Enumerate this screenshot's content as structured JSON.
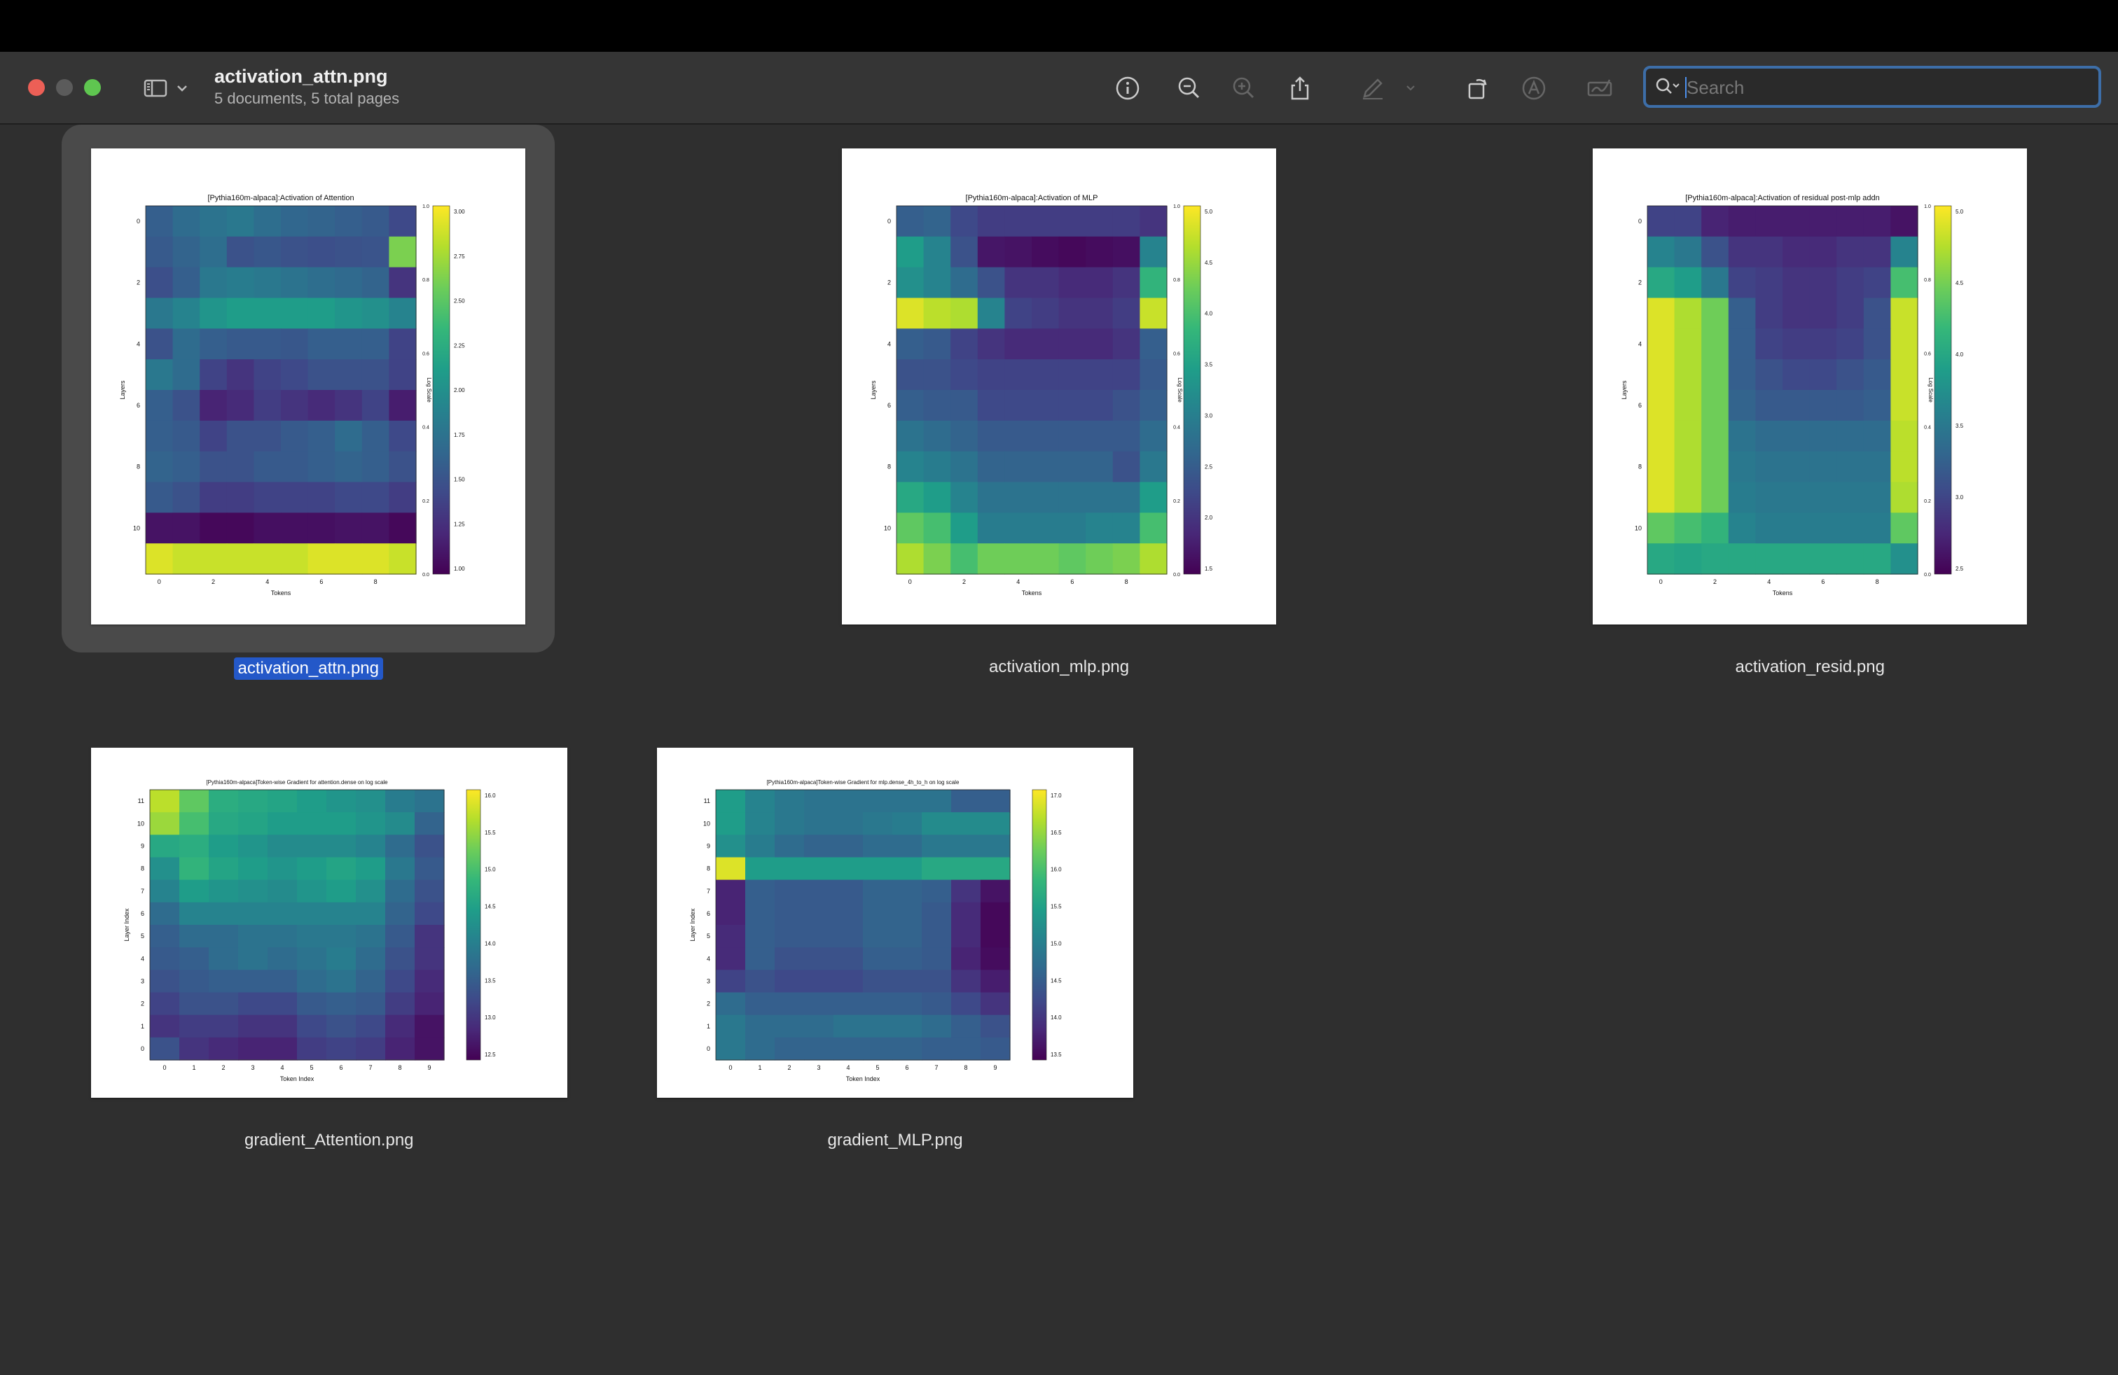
{
  "window": {
    "title": "activation_attn.png",
    "subtitle": "5 documents, 5 total pages"
  },
  "toolbar": {
    "icons": [
      "sidebar-icon",
      "chevron-down-icon",
      "info-icon",
      "zoom-out-icon",
      "zoom-in-icon",
      "share-icon",
      "markup-pen-icon",
      "chevron-down-icon",
      "rotate-icon",
      "annotate-icon",
      "signature-icon"
    ]
  },
  "search": {
    "placeholder": "Search",
    "value": ""
  },
  "files": [
    {
      "name": "activation_attn.png",
      "selected": true,
      "plot_title": "[Pythia160m-alpaca]:Activation of Attention",
      "xlabel": "Tokens",
      "ylabel": "Layers",
      "cbar_label": "Log Scale",
      "cbar_ticks": [
        "3.00",
        "2.75",
        "2.50",
        "2.25",
        "2.00",
        "1.75",
        "1.50",
        "1.25",
        "1.00"
      ],
      "axis_ticks": [
        "1.0",
        "0.8",
        "0.6",
        "0.4",
        "0.2",
        "0.0"
      ],
      "xticks": [
        "0",
        "2",
        "4",
        "6",
        "8"
      ],
      "yticks": [
        "0",
        "2",
        "4",
        "6",
        "8",
        "10"
      ]
    },
    {
      "name": "activation_mlp.png",
      "selected": false,
      "plot_title": "[Pythia160m-alpaca]:Activation of MLP",
      "xlabel": "Tokens",
      "ylabel": "Layers",
      "cbar_label": "Log Scale",
      "cbar_ticks": [
        "5.0",
        "4.5",
        "4.0",
        "3.5",
        "3.0",
        "2.5",
        "2.0",
        "1.5"
      ],
      "axis_ticks": [
        "1.0",
        "0.8",
        "0.6",
        "0.4",
        "0.2",
        "0.0"
      ],
      "xticks": [
        "0",
        "2",
        "4",
        "6",
        "8"
      ],
      "yticks": [
        "0",
        "2",
        "4",
        "6",
        "8",
        "10"
      ]
    },
    {
      "name": "activation_resid.png",
      "selected": false,
      "plot_title": "[Pythia160m-alpaca]:Activation of residual post-mlp addn",
      "xlabel": "Tokens",
      "ylabel": "Layers",
      "cbar_label": "Log Scale",
      "cbar_ticks": [
        "5.0",
        "4.5",
        "4.0",
        "3.5",
        "3.0",
        "2.5"
      ],
      "axis_ticks": [
        "1.0",
        "0.8",
        "0.6",
        "0.4",
        "0.2",
        "0.0"
      ],
      "xticks": [
        "0",
        "2",
        "4",
        "6",
        "8"
      ],
      "yticks": [
        "0",
        "2",
        "4",
        "6",
        "8",
        "10"
      ]
    },
    {
      "name": "gradient_Attention.png",
      "selected": false,
      "plot_title": "[Pythia160m-alpaca]Token-wise Gradient for attention.dense on log scale",
      "xlabel": "Token Index",
      "ylabel": "Layer Index",
      "cbar_ticks": [
        "16.0",
        "15.5",
        "15.0",
        "14.5",
        "14.0",
        "13.5",
        "13.0",
        "12.5"
      ],
      "xticks": [
        "0",
        "1",
        "2",
        "3",
        "4",
        "5",
        "6",
        "7",
        "8",
        "9"
      ],
      "yticks": [
        "11",
        "10",
        "9",
        "8",
        "7",
        "6",
        "5",
        "4",
        "3",
        "2",
        "1",
        "0"
      ]
    },
    {
      "name": "gradient_MLP.png",
      "selected": false,
      "plot_title": "[Pythia160m-alpaca]Token-wise Gradient for mlp.dense_4h_to_h on log scale",
      "xlabel": "Token Index",
      "ylabel": "Layer Index",
      "cbar_ticks": [
        "17.0",
        "16.5",
        "16.0",
        "15.5",
        "15.0",
        "14.5",
        "14.0",
        "13.5"
      ],
      "xticks": [
        "0",
        "1",
        "2",
        "3",
        "4",
        "5",
        "6",
        "7",
        "8",
        "9"
      ],
      "yticks": [
        "11",
        "10",
        "9",
        "8",
        "7",
        "6",
        "5",
        "4",
        "3",
        "2",
        "1",
        "0"
      ]
    }
  ],
  "heatmaps": [
    [
      [
        0.3,
        0.35,
        0.38,
        0.4,
        0.36,
        0.33,
        0.32,
        0.3,
        0.28,
        0.22
      ],
      [
        0.28,
        0.32,
        0.36,
        0.25,
        0.27,
        0.25,
        0.24,
        0.25,
        0.26,
        0.8
      ],
      [
        0.24,
        0.3,
        0.4,
        0.42,
        0.4,
        0.38,
        0.36,
        0.34,
        0.32,
        0.15
      ],
      [
        0.4,
        0.45,
        0.52,
        0.55,
        0.55,
        0.55,
        0.55,
        0.52,
        0.5,
        0.45
      ],
      [
        0.25,
        0.35,
        0.3,
        0.28,
        0.28,
        0.27,
        0.3,
        0.3,
        0.3,
        0.2
      ],
      [
        0.4,
        0.35,
        0.2,
        0.15,
        0.2,
        0.22,
        0.25,
        0.25,
        0.25,
        0.2
      ],
      [
        0.3,
        0.25,
        0.1,
        0.12,
        0.18,
        0.15,
        0.12,
        0.15,
        0.2,
        0.08
      ],
      [
        0.3,
        0.28,
        0.2,
        0.25,
        0.25,
        0.28,
        0.3,
        0.35,
        0.3,
        0.22
      ],
      [
        0.32,
        0.3,
        0.25,
        0.25,
        0.28,
        0.28,
        0.3,
        0.32,
        0.3,
        0.25
      ],
      [
        0.28,
        0.25,
        0.18,
        0.18,
        0.2,
        0.2,
        0.2,
        0.22,
        0.22,
        0.18
      ],
      [
        0.05,
        0.05,
        0.02,
        0.02,
        0.04,
        0.04,
        0.04,
        0.05,
        0.05,
        0.02
      ],
      [
        0.95,
        0.92,
        0.92,
        0.92,
        0.92,
        0.92,
        0.95,
        0.95,
        0.95,
        0.92
      ]
    ],
    [
      [
        0.3,
        0.32,
        0.22,
        0.18,
        0.18,
        0.18,
        0.18,
        0.18,
        0.18,
        0.15
      ],
      [
        0.55,
        0.45,
        0.25,
        0.06,
        0.05,
        0.03,
        0.02,
        0.03,
        0.04,
        0.45
      ],
      [
        0.5,
        0.45,
        0.35,
        0.25,
        0.15,
        0.15,
        0.12,
        0.12,
        0.15,
        0.65
      ],
      [
        0.95,
        0.9,
        0.88,
        0.45,
        0.2,
        0.18,
        0.15,
        0.15,
        0.18,
        0.92
      ],
      [
        0.3,
        0.28,
        0.2,
        0.15,
        0.12,
        0.12,
        0.12,
        0.12,
        0.15,
        0.3
      ],
      [
        0.25,
        0.25,
        0.22,
        0.2,
        0.2,
        0.2,
        0.2,
        0.2,
        0.2,
        0.28
      ],
      [
        0.3,
        0.28,
        0.28,
        0.22,
        0.22,
        0.22,
        0.22,
        0.22,
        0.25,
        0.3
      ],
      [
        0.38,
        0.35,
        0.32,
        0.28,
        0.28,
        0.28,
        0.28,
        0.28,
        0.28,
        0.35
      ],
      [
        0.45,
        0.42,
        0.38,
        0.32,
        0.32,
        0.32,
        0.32,
        0.32,
        0.25,
        0.4
      ],
      [
        0.6,
        0.55,
        0.45,
        0.38,
        0.38,
        0.38,
        0.38,
        0.38,
        0.38,
        0.55
      ],
      [
        0.75,
        0.7,
        0.55,
        0.42,
        0.42,
        0.42,
        0.42,
        0.45,
        0.45,
        0.7
      ],
      [
        0.88,
        0.8,
        0.7,
        0.78,
        0.78,
        0.78,
        0.75,
        0.78,
        0.8,
        0.88
      ]
    ],
    [
      [
        0.2,
        0.2,
        0.1,
        0.08,
        0.08,
        0.08,
        0.08,
        0.08,
        0.08,
        0.05
      ],
      [
        0.45,
        0.4,
        0.25,
        0.15,
        0.15,
        0.12,
        0.12,
        0.15,
        0.15,
        0.45
      ],
      [
        0.6,
        0.55,
        0.4,
        0.2,
        0.18,
        0.15,
        0.15,
        0.18,
        0.2,
        0.7
      ],
      [
        0.95,
        0.88,
        0.78,
        0.3,
        0.18,
        0.15,
        0.15,
        0.18,
        0.25,
        0.92
      ],
      [
        0.95,
        0.88,
        0.78,
        0.3,
        0.2,
        0.18,
        0.18,
        0.2,
        0.25,
        0.92
      ],
      [
        0.95,
        0.88,
        0.78,
        0.3,
        0.25,
        0.22,
        0.22,
        0.25,
        0.28,
        0.92
      ],
      [
        0.95,
        0.88,
        0.78,
        0.32,
        0.28,
        0.28,
        0.28,
        0.28,
        0.3,
        0.92
      ],
      [
        0.95,
        0.88,
        0.78,
        0.38,
        0.35,
        0.35,
        0.35,
        0.35,
        0.35,
        0.9
      ],
      [
        0.95,
        0.88,
        0.78,
        0.4,
        0.38,
        0.38,
        0.38,
        0.38,
        0.38,
        0.9
      ],
      [
        0.95,
        0.88,
        0.78,
        0.42,
        0.4,
        0.4,
        0.4,
        0.4,
        0.4,
        0.88
      ],
      [
        0.75,
        0.7,
        0.65,
        0.45,
        0.42,
        0.42,
        0.42,
        0.42,
        0.42,
        0.75
      ],
      [
        0.6,
        0.58,
        0.6,
        0.6,
        0.6,
        0.6,
        0.6,
        0.6,
        0.6,
        0.5
      ]
    ],
    [
      [
        0.9,
        0.75,
        0.62,
        0.6,
        0.58,
        0.55,
        0.52,
        0.5,
        0.42,
        0.38
      ],
      [
        0.85,
        0.7,
        0.6,
        0.58,
        0.55,
        0.55,
        0.55,
        0.52,
        0.48,
        0.32
      ],
      [
        0.6,
        0.62,
        0.55,
        0.52,
        0.48,
        0.48,
        0.48,
        0.45,
        0.35,
        0.25
      ],
      [
        0.5,
        0.65,
        0.58,
        0.55,
        0.52,
        0.55,
        0.58,
        0.55,
        0.4,
        0.28
      ],
      [
        0.45,
        0.55,
        0.52,
        0.5,
        0.48,
        0.52,
        0.55,
        0.5,
        0.35,
        0.25
      ],
      [
        0.35,
        0.45,
        0.45,
        0.45,
        0.45,
        0.45,
        0.45,
        0.45,
        0.32,
        0.22
      ],
      [
        0.3,
        0.35,
        0.35,
        0.38,
        0.38,
        0.4,
        0.4,
        0.38,
        0.28,
        0.15
      ],
      [
        0.28,
        0.3,
        0.35,
        0.38,
        0.35,
        0.38,
        0.42,
        0.35,
        0.25,
        0.15
      ],
      [
        0.25,
        0.28,
        0.3,
        0.3,
        0.3,
        0.35,
        0.38,
        0.32,
        0.22,
        0.12
      ],
      [
        0.2,
        0.25,
        0.25,
        0.22,
        0.22,
        0.28,
        0.3,
        0.28,
        0.18,
        0.1
      ],
      [
        0.15,
        0.18,
        0.18,
        0.15,
        0.15,
        0.22,
        0.25,
        0.22,
        0.12,
        0.05
      ],
      [
        0.25,
        0.15,
        0.12,
        0.1,
        0.1,
        0.18,
        0.2,
        0.18,
        0.1,
        0.05
      ]
    ],
    [
      [
        0.55,
        0.45,
        0.4,
        0.38,
        0.38,
        0.38,
        0.38,
        0.38,
        0.3,
        0.3
      ],
      [
        0.55,
        0.45,
        0.4,
        0.38,
        0.38,
        0.4,
        0.42,
        0.48,
        0.48,
        0.48
      ],
      [
        0.5,
        0.42,
        0.35,
        0.32,
        0.32,
        0.35,
        0.35,
        0.4,
        0.4,
        0.4
      ],
      [
        0.95,
        0.55,
        0.55,
        0.55,
        0.55,
        0.55,
        0.55,
        0.6,
        0.6,
        0.6
      ],
      [
        0.1,
        0.3,
        0.28,
        0.28,
        0.28,
        0.32,
        0.32,
        0.3,
        0.15,
        0.05
      ],
      [
        0.1,
        0.3,
        0.28,
        0.28,
        0.28,
        0.32,
        0.32,
        0.28,
        0.12,
        0.02
      ],
      [
        0.12,
        0.3,
        0.28,
        0.28,
        0.28,
        0.32,
        0.32,
        0.28,
        0.12,
        0.02
      ],
      [
        0.12,
        0.3,
        0.25,
        0.25,
        0.25,
        0.3,
        0.3,
        0.28,
        0.1,
        0.03
      ],
      [
        0.2,
        0.25,
        0.22,
        0.22,
        0.22,
        0.25,
        0.25,
        0.25,
        0.15,
        0.08
      ],
      [
        0.35,
        0.3,
        0.3,
        0.3,
        0.3,
        0.3,
        0.3,
        0.28,
        0.22,
        0.15
      ],
      [
        0.4,
        0.35,
        0.35,
        0.35,
        0.38,
        0.38,
        0.38,
        0.35,
        0.3,
        0.25
      ],
      [
        0.4,
        0.35,
        0.32,
        0.32,
        0.32,
        0.32,
        0.32,
        0.3,
        0.3,
        0.28
      ]
    ]
  ]
}
